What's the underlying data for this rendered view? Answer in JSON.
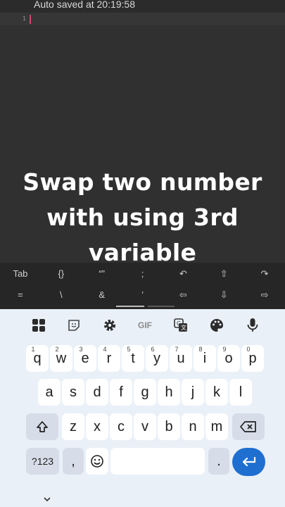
{
  "editor": {
    "autosave": "Auto saved at 20:19:58",
    "line_number": "1"
  },
  "caption": {
    "line1": "Swap two number",
    "line2": "with using 3rd",
    "line3": "variable"
  },
  "extra_keys": {
    "row1": [
      "Tab",
      "{}",
      "“”",
      ";",
      "↶",
      "⇧",
      "↷"
    ],
    "row2": [
      "=",
      "\\",
      "&",
      "’",
      "⇦",
      "⇩",
      "⇨"
    ]
  },
  "keyboard": {
    "toolbar_icons": [
      "apps-grid-icon",
      "sticker-icon",
      "settings-gear-icon",
      "gif-icon",
      "translate-icon",
      "palette-icon",
      "microphone-icon"
    ],
    "gif_label": "GIF",
    "row1": [
      {
        "key": "q",
        "hint": "1"
      },
      {
        "key": "w",
        "hint": "2"
      },
      {
        "key": "e",
        "hint": "3"
      },
      {
        "key": "r",
        "hint": "4"
      },
      {
        "key": "t",
        "hint": "5"
      },
      {
        "key": "y",
        "hint": "6"
      },
      {
        "key": "u",
        "hint": "7"
      },
      {
        "key": "i",
        "hint": "8"
      },
      {
        "key": "o",
        "hint": "9"
      },
      {
        "key": "p",
        "hint": "0"
      }
    ],
    "row2": [
      "a",
      "s",
      "d",
      "f",
      "g",
      "h",
      "j",
      "k",
      "l"
    ],
    "row3": [
      "z",
      "x",
      "c",
      "v",
      "b",
      "n",
      "m"
    ],
    "symbols_label": "?123",
    "comma_label": ",",
    "period_label": "."
  }
}
